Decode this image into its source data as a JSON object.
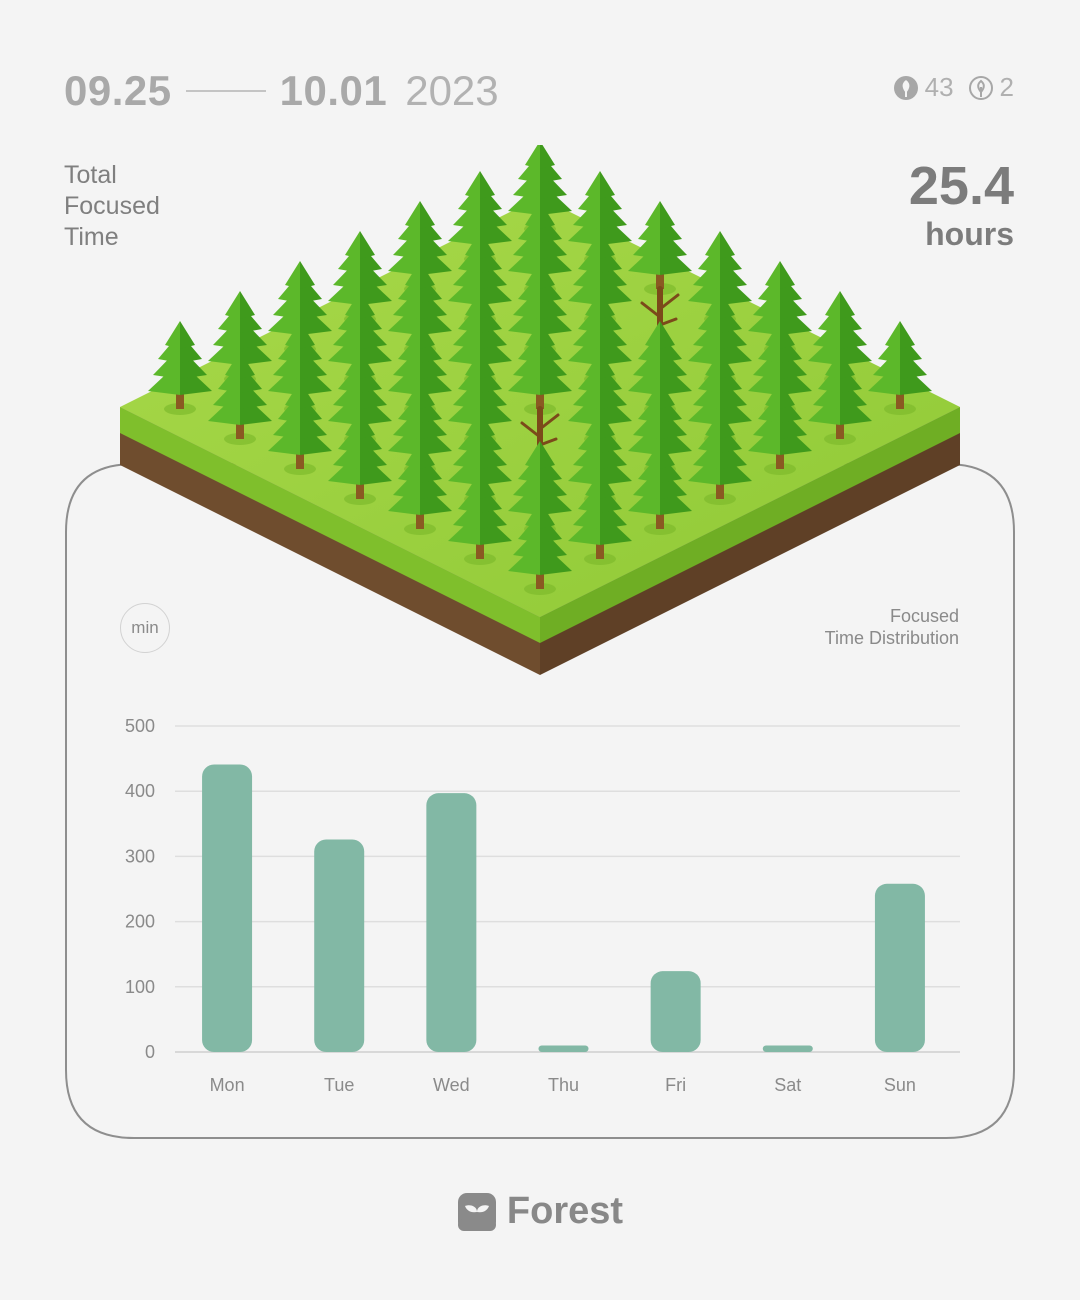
{
  "header": {
    "start_date": "09.25",
    "end_date": "10.01",
    "year": "2023",
    "healthy_tree_count": "43",
    "withered_tree_count": "2"
  },
  "summary": {
    "label": "Total\nFocused\nTime",
    "value": "25.4",
    "unit": "hours"
  },
  "chart_badge": "min",
  "chart_data": {
    "type": "bar",
    "title": "Focused\nTime Distribution",
    "categories": [
      "Mon",
      "Tue",
      "Wed",
      "Thu",
      "Fri",
      "Sat",
      "Sun"
    ],
    "values": [
      441,
      326,
      397,
      10,
      124,
      10,
      258
    ],
    "yticks": [
      0,
      100,
      200,
      300,
      400,
      500
    ],
    "ylim": [
      0,
      500
    ],
    "ylabel": "",
    "xlabel": "",
    "grid": true,
    "bar_color": "#82b8a5"
  },
  "brand": {
    "name": "Forest"
  },
  "colors": {
    "grass": "#9ccf3c",
    "soil": "#7a5736",
    "tree": "#4aa31f",
    "text": "#8a8a8a"
  },
  "icons": [
    "leaf-tree-icon",
    "withered-tree-icon",
    "forest-logo-icon"
  ]
}
